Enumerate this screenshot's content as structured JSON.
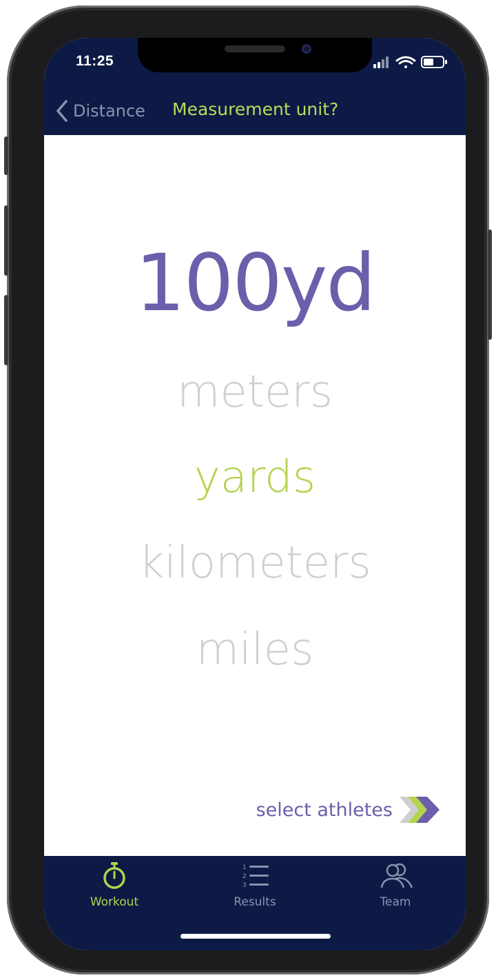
{
  "status_bar": {
    "time": "11:25"
  },
  "nav": {
    "back_label": "Distance",
    "title": "Measurement unit?"
  },
  "main": {
    "distance_display": "100yd",
    "units": [
      {
        "label": "meters",
        "selected": false
      },
      {
        "label": "yards",
        "selected": true
      },
      {
        "label": "kilometers",
        "selected": false
      },
      {
        "label": "miles",
        "selected": false
      }
    ],
    "next_label": "select athletes"
  },
  "tabbar": {
    "tabs": [
      {
        "label": "Workout",
        "icon": "stopwatch-icon",
        "active": true
      },
      {
        "label": "Results",
        "icon": "ranked-list-icon",
        "active": false
      },
      {
        "label": "Team",
        "icon": "team-icon",
        "active": false
      }
    ]
  },
  "colors": {
    "navy": "#0d1a45",
    "accent_green": "#b3d44d",
    "accent_purple": "#6c5eaa",
    "inactive_gray": "#cfcfcf",
    "tab_inactive": "#8a92ad"
  }
}
